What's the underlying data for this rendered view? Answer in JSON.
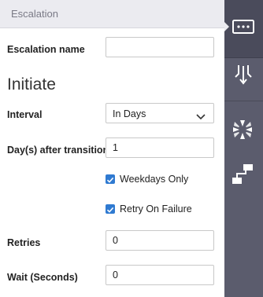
{
  "header": {
    "title": "Escalation"
  },
  "fields": {
    "escalation_name": {
      "label": "Escalation name",
      "value": ""
    },
    "section_title": "Initiate",
    "interval": {
      "label": "Interval",
      "value": "In Days"
    },
    "days_after": {
      "label": "Day(s) after transition",
      "value": "1"
    },
    "weekdays_only": {
      "label": "Weekdays Only",
      "checked": true
    },
    "retry_on_failure": {
      "label": "Retry On Failure",
      "checked": true
    },
    "retries": {
      "label": "Retries",
      "value": "0"
    },
    "wait_seconds": {
      "label": "Wait (Seconds)",
      "value": "0"
    }
  },
  "rail": {
    "icons": [
      "message-icon",
      "merge-icon",
      "collapse-icon",
      "flow-icon"
    ]
  },
  "colors": {
    "header_bg": "#ebebf0",
    "rail_bg": "#5b5c6d",
    "rail_active_bg": "#4a4b5b",
    "checkbox_accent": "#2f7ad1"
  }
}
